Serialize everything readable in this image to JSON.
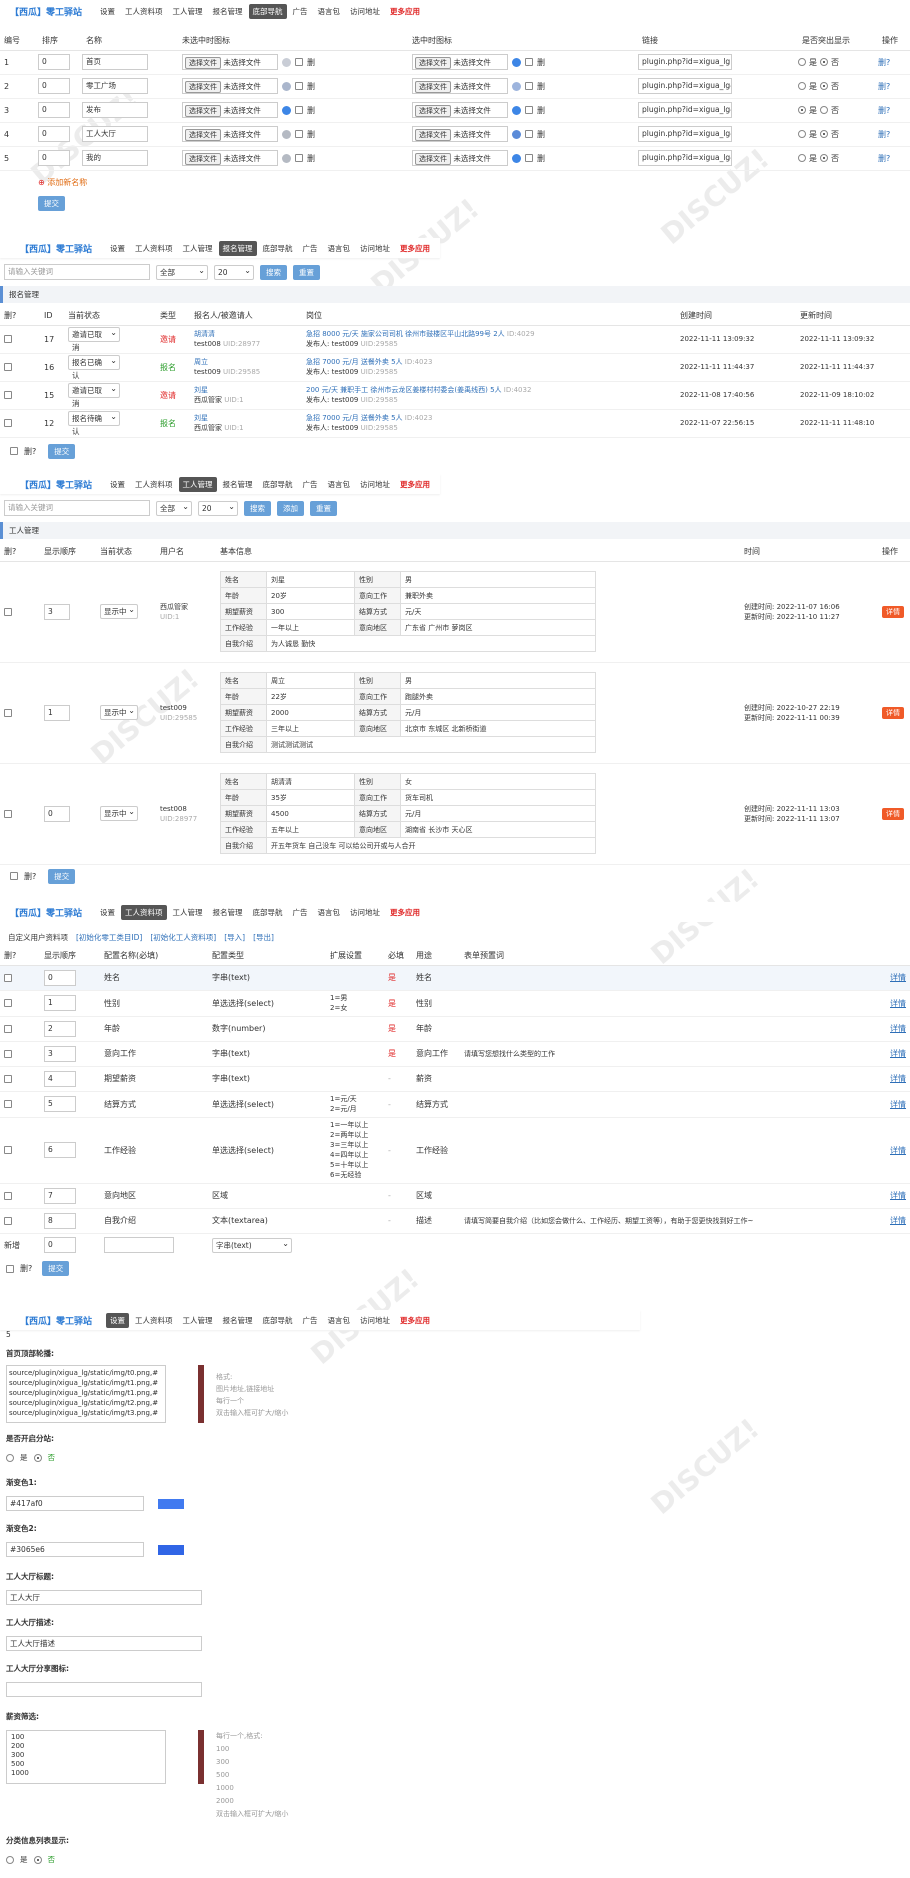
{
  "nav": {
    "title": "【西瓜】零工驿站",
    "tabs": [
      "设置",
      "工人资料项",
      "工人管理",
      "报名管理",
      "底部导航",
      "广告",
      "语言包",
      "访问地址"
    ],
    "more": "更多应用"
  },
  "sec1": {
    "headers": [
      "编号",
      "排序",
      "名称",
      "未选中时图标",
      "选中时图标",
      "链接",
      "是否突出显示",
      "操作"
    ],
    "rows": [
      {
        "no": "1",
        "order": "0",
        "name": "首页",
        "link": "plugin.php?id=xigua_lg",
        "hl": "否"
      },
      {
        "no": "2",
        "order": "0",
        "name": "零工广场",
        "link": "plugin.php?id=xigua_lg&",
        "hl": "否"
      },
      {
        "no": "3",
        "order": "0",
        "name": "发布",
        "link": "plugin.php?id=xigua_lg&",
        "hl": "是"
      },
      {
        "no": "4",
        "order": "0",
        "name": "工人大厅",
        "link": "plugin.php?id=xigua_lg&",
        "hl": "否"
      },
      {
        "no": "5",
        "order": "0",
        "name": "我的",
        "link": "plugin.php?id=xigua_lg&",
        "hl": "否"
      }
    ],
    "file_btn": "选择文件",
    "no_file": "未选择文件",
    "del": "删",
    "yes": "是",
    "no": "否",
    "op": "删?",
    "add": "添加新名称",
    "submit": "提交"
  },
  "sec2": {
    "search_placeholder": "请输入关键词",
    "filter": "全部",
    "pagesize": "20",
    "search": "搜索",
    "reset": "重置",
    "panel": "报名管理",
    "headers": [
      "删?",
      "ID",
      "当前状态",
      "类型",
      "报名人/被邀请人",
      "岗位",
      "创建时间",
      "更新时间"
    ],
    "rows": [
      {
        "id": "17",
        "status": "邀请已取消",
        "type": "邀请",
        "p1": "胡清清",
        "p2": "test008",
        "uid": "UID:28977",
        "job": "急招 8000 元/天 施家公司司机 徐州市鼓楼区平山北路99号 2人",
        "jid": "ID:4029",
        "pub": "发布人: test009",
        "puid": "UID:29585",
        "c": "2022-11-11 13:09:32",
        "u": "2022-11-11 13:09:32"
      },
      {
        "id": "16",
        "status": "报名已确认",
        "type": "报名",
        "p1": "周立",
        "p2": "test009",
        "uid": "UID:29585",
        "job": "急招 7000 元/月 送餐外卖 5人",
        "jid": "ID:4023",
        "pub": "发布人: test009",
        "puid": "UID:29585",
        "c": "2022-11-11 11:44:37",
        "u": "2022-11-11 11:44:37"
      },
      {
        "id": "15",
        "status": "邀请已取消",
        "type": "邀请",
        "p1": "刘星",
        "p2": "西瓜管家",
        "uid": "UID:1",
        "job": "200 元/天 兼职手工 徐州市云龙区姜楼村村委会(姜禹线西) 5人",
        "jid": "ID:4032",
        "pub": "发布人: test009",
        "puid": "UID:29585",
        "c": "2022-11-08 17:40:56",
        "u": "2022-11-09 18:10:02"
      },
      {
        "id": "12",
        "status": "报名待确认",
        "type": "报名",
        "p1": "刘星",
        "p2": "西瓜管家",
        "uid": "UID:1",
        "job": "急招 7000 元/月 送餐外卖 5人",
        "jid": "ID:4023",
        "pub": "发布人: test009",
        "puid": "UID:29585",
        "c": "2022-11-07 22:56:15",
        "u": "2022-11-11 11:48:10"
      }
    ],
    "del": "删?",
    "submit": "提交"
  },
  "sec3": {
    "search_placeholder": "请输入关键词",
    "filter": "全部",
    "pagesize": "20",
    "search": "搜索",
    "add": "添加",
    "reset": "重置",
    "panel": "工人管理",
    "headers": [
      "删?",
      "显示顺序",
      "当前状态",
      "用户名",
      "基本信息",
      "时间",
      "操作"
    ],
    "keys": {
      "name": "姓名",
      "gender": "性别",
      "age": "年龄",
      "job": "意向工作",
      "salary": "期望薪资",
      "settle": "结算方式",
      "exp": "工作经验",
      "area": "意向地区",
      "intro": "自我介绍"
    },
    "rows": [
      {
        "order": "3",
        "status": "显示中",
        "user": "西瓜管家",
        "uid": "UID:1",
        "name": "刘星",
        "gender": "男",
        "age": "20岁",
        "job": "兼职外卖",
        "salary": "300",
        "settle": "元/天",
        "exp": "一年以上",
        "area": "广东省 广州市 萝岗区",
        "intro": "为人诚恳 勤快",
        "c": "创建时间: 2022-11-07 16:06",
        "u": "更新时间: 2022-11-10 11:27"
      },
      {
        "order": "1",
        "status": "显示中",
        "user": "test009",
        "uid": "UID:29585",
        "name": "周立",
        "gender": "男",
        "age": "22岁",
        "job": "跑腿外卖",
        "salary": "2000",
        "settle": "元/月",
        "exp": "三年以上",
        "area": "北京市 东城区 北新桥街道",
        "intro": "测试测试测试",
        "c": "创建时间: 2022-10-27 22:19",
        "u": "更新时间: 2022-11-11 00:39"
      },
      {
        "order": "0",
        "status": "显示中",
        "user": "test008",
        "uid": "UID:28977",
        "name": "胡清清",
        "gender": "女",
        "age": "35岁",
        "job": "货车司机",
        "salary": "4500",
        "settle": "元/月",
        "exp": "五年以上",
        "area": "湖南省 长沙市 天心区",
        "intro": "开五年货车 自己没车 可以给公司开或与人合开",
        "c": "创建时间: 2022-11-11 13:03",
        "u": "更新时间: 2022-11-11 13:07"
      }
    ],
    "detail": "详情",
    "del": "删?",
    "submit": "提交"
  },
  "sec4": {
    "links": [
      "自定义用户资料项",
      "[初始化零工类目ID]",
      "[初始化工人资料项]",
      "[导入]",
      "[导出]"
    ],
    "headers": [
      "删?",
      "显示顺序",
      "配置名称(必填)",
      "配置类型",
      "扩展设置",
      "必填",
      "用途",
      "表单预置词"
    ],
    "rows": [
      {
        "order": "0",
        "name": "姓名",
        "type": "字串(text)",
        "ext": "",
        "req": "是",
        "use": "姓名",
        "pre": ""
      },
      {
        "order": "1",
        "name": "性别",
        "type": "单选选择(select)",
        "ext": "1=男\n2=女",
        "req": "是",
        "use": "性别",
        "pre": ""
      },
      {
        "order": "2",
        "name": "年龄",
        "type": "数字(number)",
        "ext": "",
        "req": "是",
        "use": "年龄",
        "pre": ""
      },
      {
        "order": "3",
        "name": "意向工作",
        "type": "字串(text)",
        "ext": "",
        "req": "是",
        "use": "意向工作",
        "pre": "请填写您想找什么类型的工作"
      },
      {
        "order": "4",
        "name": "期望薪资",
        "type": "字串(text)",
        "ext": "",
        "req": "-",
        "use": "薪资",
        "pre": ""
      },
      {
        "order": "5",
        "name": "结算方式",
        "type": "单选选择(select)",
        "ext": "1=元/天\n2=元/月",
        "req": "-",
        "use": "结算方式",
        "pre": ""
      },
      {
        "order": "6",
        "name": "工作经验",
        "type": "单选选择(select)",
        "ext": "1=一年以上\n2=两年以上\n3=三年以上\n4=四年以上\n5=十年以上\n6=无经验",
        "req": "-",
        "use": "工作经验",
        "pre": ""
      },
      {
        "order": "7",
        "name": "意向地区",
        "type": "区域",
        "ext": "",
        "req": "-",
        "use": "区域",
        "pre": ""
      },
      {
        "order": "8",
        "name": "自我介绍",
        "type": "文本(textarea)",
        "ext": "",
        "req": "-",
        "use": "描述",
        "pre": "请填写简要自我介绍（比如您会做什么、工作经历、期望工资等），有助于您更快找到好工作~"
      }
    ],
    "detail": "详情",
    "new_label": "新增",
    "new_order": "0",
    "new_type": "字串(text)",
    "del": "删?",
    "submit": "提交"
  },
  "sec5": {
    "top_value": "5",
    "banner_label": "首页顶部轮播:",
    "banner_lines": [
      "source/plugin/xigua_lg/static/img/t0.png,#",
      "source/plugin/xigua_lg/static/img/t1.png,#",
      "source/plugin/xigua_lg/static/img/t1.png,#",
      "source/plugin/xigua_lg/static/img/t2.png,#",
      "source/plugin/xigua_lg/static/img/t3.png,#"
    ],
    "banner_hint": [
      "格式:",
      "图片地址,链接地址",
      "每行一个",
      "双击输入框可扩大/缩小"
    ],
    "share_label": "是否开启分站:",
    "yes": "是",
    "no": "否",
    "color1_label": "渐变色1:",
    "color1": "#417af0",
    "color2_label": "渐变色2:",
    "color2": "#3065e6",
    "hall_title_label": "工人大厅标题:",
    "hall_title": "工人大厅",
    "hall_desc_label": "工人大厅描述:",
    "hall_desc": "工人大厅描述",
    "hall_icon_label": "工人大厅分享图标:",
    "salary_label": "薪资筛选:",
    "salary_lines": [
      "100",
      "200",
      "300",
      "500",
      "1000"
    ],
    "salary_hint": [
      "每行一个,格式:",
      "100",
      "300",
      "500",
      "1000",
      "2000",
      "双击输入框可扩大/缩小"
    ],
    "cat_label": "分类信息列表显示:"
  }
}
